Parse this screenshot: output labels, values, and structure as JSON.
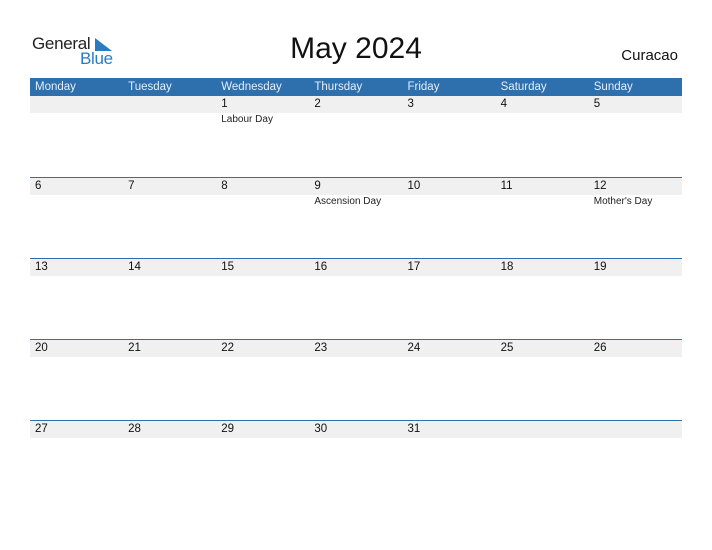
{
  "logo": {
    "line1": "General",
    "line2": "Blue",
    "accent_color": "#2a7bc1"
  },
  "title": "May 2024",
  "country": "Curacao",
  "colors": {
    "header_bg": "#2e6fae",
    "band_bg": "#f0f0f0"
  },
  "weekdays": [
    "Monday",
    "Tuesday",
    "Wednesday",
    "Thursday",
    "Friday",
    "Saturday",
    "Sunday"
  ],
  "weeks": [
    [
      {
        "day": "",
        "event": ""
      },
      {
        "day": "",
        "event": ""
      },
      {
        "day": "1",
        "event": "Labour Day"
      },
      {
        "day": "2",
        "event": ""
      },
      {
        "day": "3",
        "event": ""
      },
      {
        "day": "4",
        "event": ""
      },
      {
        "day": "5",
        "event": ""
      }
    ],
    [
      {
        "day": "6",
        "event": ""
      },
      {
        "day": "7",
        "event": ""
      },
      {
        "day": "8",
        "event": ""
      },
      {
        "day": "9",
        "event": "Ascension Day"
      },
      {
        "day": "10",
        "event": ""
      },
      {
        "day": "11",
        "event": ""
      },
      {
        "day": "12",
        "event": "Mother's Day"
      }
    ],
    [
      {
        "day": "13",
        "event": ""
      },
      {
        "day": "14",
        "event": ""
      },
      {
        "day": "15",
        "event": ""
      },
      {
        "day": "16",
        "event": ""
      },
      {
        "day": "17",
        "event": ""
      },
      {
        "day": "18",
        "event": ""
      },
      {
        "day": "19",
        "event": ""
      }
    ],
    [
      {
        "day": "20",
        "event": ""
      },
      {
        "day": "21",
        "event": ""
      },
      {
        "day": "22",
        "event": ""
      },
      {
        "day": "23",
        "event": ""
      },
      {
        "day": "24",
        "event": ""
      },
      {
        "day": "25",
        "event": ""
      },
      {
        "day": "26",
        "event": ""
      }
    ],
    [
      {
        "day": "27",
        "event": ""
      },
      {
        "day": "28",
        "event": ""
      },
      {
        "day": "29",
        "event": ""
      },
      {
        "day": "30",
        "event": ""
      },
      {
        "day": "31",
        "event": ""
      },
      {
        "day": "",
        "event": ""
      },
      {
        "day": "",
        "event": ""
      }
    ]
  ]
}
